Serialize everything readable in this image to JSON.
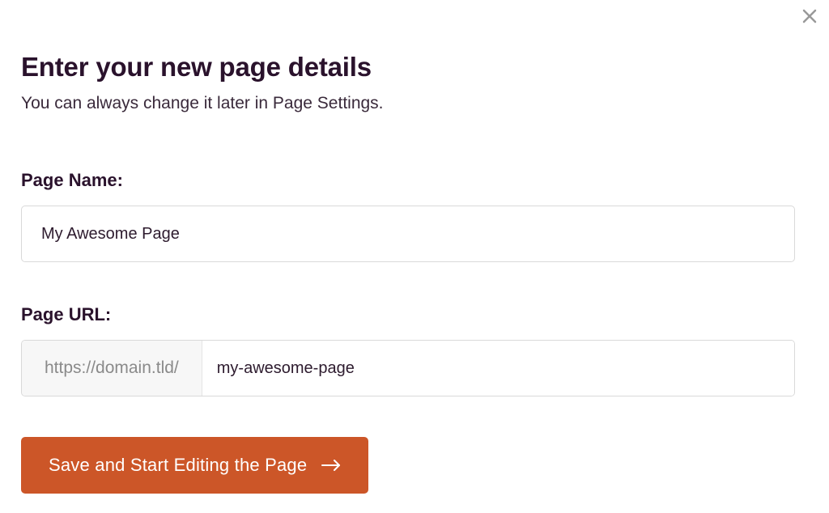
{
  "dialog": {
    "title": "Enter your new page details",
    "subtitle": "You can always change it later in Page Settings."
  },
  "fields": {
    "page_name": {
      "label": "Page Name:",
      "value": "My Awesome Page"
    },
    "page_url": {
      "label": "Page URL:",
      "prefix": "https://domain.tld/",
      "value": "my-awesome-page"
    }
  },
  "actions": {
    "submit_label": "Save and Start Editing the Page"
  }
}
